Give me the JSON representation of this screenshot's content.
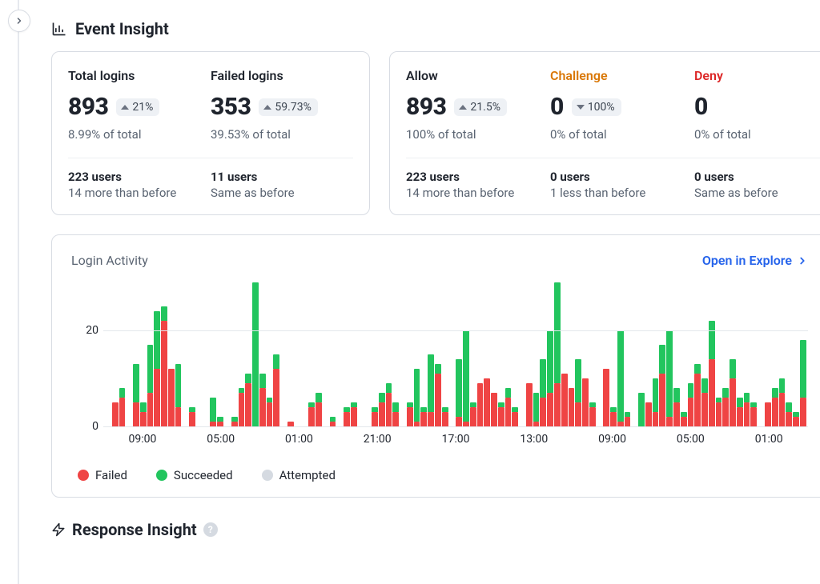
{
  "header": {
    "event_insight": "Event Insight",
    "response_insight": "Response Insight"
  },
  "card_logins": {
    "metrics": [
      {
        "title": "Total logins",
        "value": "893",
        "delta_dir": "up",
        "delta": "21%",
        "share": "8.99% of total",
        "users": "223 users",
        "users_delta": "14 more than before"
      },
      {
        "title": "Failed logins",
        "value": "353",
        "delta_dir": "up",
        "delta": "59.73%",
        "share": "39.53% of total",
        "users": "11 users",
        "users_delta": "Same as before"
      }
    ]
  },
  "card_actions": {
    "metrics": [
      {
        "title": "Allow",
        "title_class": "",
        "value": "893",
        "delta_dir": "up",
        "delta": "21.5%",
        "share": "100% of total",
        "users": "223 users",
        "users_delta": "14 more than before"
      },
      {
        "title": "Challenge",
        "title_class": "orange",
        "value": "0",
        "delta_dir": "down",
        "delta": "100%",
        "share": "0% of total",
        "users": "0 users",
        "users_delta": "1 less than before"
      },
      {
        "title": "Deny",
        "title_class": "red",
        "value": "0",
        "delta_dir": "",
        "delta": "",
        "share": "0% of total",
        "users": "0 users",
        "users_delta": "Same as before"
      }
    ]
  },
  "chart": {
    "title": "Login Activity",
    "open_label": "Open in Explore",
    "legend": {
      "failed": "Failed",
      "succeeded": "Succeeded",
      "attempted": "Attempted"
    }
  },
  "chart_data": {
    "type": "bar",
    "ylabel": "",
    "ylim": [
      0,
      30
    ],
    "yticks": [
      0,
      20
    ],
    "xticks": [
      "09:00",
      "05:00",
      "01:00",
      "21:00",
      "17:00",
      "13:00",
      "09:00",
      "05:00",
      "01:00"
    ],
    "categories_count": 90,
    "series": [
      {
        "name": "Succeeded",
        "color": "#22c55e",
        "values": [
          0,
          3,
          8,
          0,
          13,
          5,
          17,
          24,
          25,
          8,
          13,
          0,
          4,
          0,
          0,
          6,
          2,
          0,
          2,
          8,
          11,
          30,
          11,
          6,
          15,
          0,
          1,
          0,
          0,
          5,
          7,
          0,
          2,
          0,
          4,
          5,
          0,
          0,
          4,
          7,
          9,
          5,
          0,
          5,
          12,
          4,
          15,
          13,
          4,
          0,
          14,
          20,
          5,
          7,
          5,
          6,
          5,
          8,
          4,
          0,
          8,
          7,
          14,
          20,
          30,
          10,
          8,
          14,
          8,
          5,
          0,
          10,
          4,
          20,
          3,
          0,
          7,
          5,
          10,
          17,
          20,
          8,
          3,
          9,
          13,
          10,
          22,
          6,
          8,
          14,
          6,
          7,
          5,
          0,
          5,
          8,
          10,
          5,
          3,
          18
        ]
      },
      {
        "name": "Failed",
        "color": "#ef4444",
        "values": [
          0,
          5,
          6,
          0,
          5,
          3,
          7,
          12,
          22,
          12,
          4,
          0,
          3,
          0,
          0,
          1,
          1,
          0,
          1,
          7,
          9,
          0,
          8,
          5,
          12,
          0,
          1,
          0,
          0,
          4,
          5,
          0,
          1,
          0,
          3,
          4,
          0,
          0,
          3,
          5,
          7,
          3,
          0,
          4,
          1,
          3,
          3,
          11,
          3,
          0,
          2,
          1,
          4,
          9,
          10,
          7,
          4,
          6,
          3,
          0,
          9,
          1,
          6,
          7,
          9,
          11,
          8,
          5,
          10,
          4,
          0,
          12,
          3,
          1,
          2,
          0,
          0,
          5,
          3,
          11,
          2,
          5,
          2,
          6,
          11,
          7,
          14,
          5,
          6,
          10,
          4,
          5,
          4,
          0,
          5,
          6,
          7,
          3,
          2,
          6
        ]
      }
    ]
  }
}
